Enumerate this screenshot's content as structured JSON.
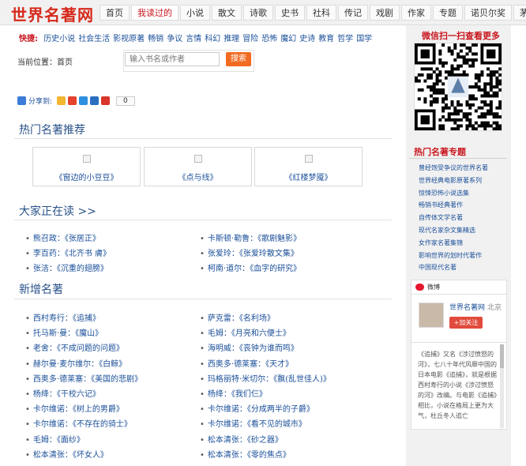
{
  "site": {
    "logo": "世界名著网"
  },
  "nav": [
    "首页",
    "我读过的",
    "小说",
    "散文",
    "诗歌",
    "史书",
    "社科",
    "传记",
    "戏剧",
    "作家",
    "专题",
    "诺贝尔奖",
    "茅奖"
  ],
  "nav_active_index": 1,
  "quick": {
    "label": "快捷:",
    "links": [
      "历史小说",
      "社会生活",
      "影视原著",
      "畅销",
      "争议",
      "言情",
      "科幻",
      "推理",
      "冒险",
      "恐怖",
      "魔幻",
      "史诗",
      "教育",
      "哲学",
      "国学"
    ]
  },
  "location": {
    "label": "当前位置：",
    "current": "首页"
  },
  "search": {
    "placeholder": "输入书名或作者",
    "button": "搜索"
  },
  "share": {
    "label": "分享到:",
    "count": "0"
  },
  "sections": {
    "hot": "热门名著推荐",
    "reading": "大家正在读 >>",
    "new": "新增名著"
  },
  "recommend": [
    "《窗边的小豆豆》",
    "《点与线》",
    "《红楼梦魇》"
  ],
  "reading_list": [
    {
      "author": "熊召政",
      "book": "《张居正》"
    },
    {
      "author": "卡斯顿·勒鲁",
      "book": "《歌剧魅影》"
    },
    {
      "author": "李百药",
      "book": "《北齐书 膚》"
    },
    {
      "author": "张爱玲",
      "book": "《张爱玲散文集》"
    },
    {
      "author": "张洁",
      "book": "《沉重的翅膀》"
    },
    {
      "author": "柯南·道尔",
      "book": "《血字的研究》"
    }
  ],
  "new_list": [
    {
      "author": "西村寿行",
      "book": "《追捕》"
    },
    {
      "author": "萨克雷",
      "book": "《名利场》"
    },
    {
      "author": "托马斯·曼",
      "book": "《魔山》"
    },
    {
      "author": "毛姆",
      "book": "《月亮和六便士》"
    },
    {
      "author": "老舍",
      "book": "《不成问题的问题》"
    },
    {
      "author": "海明威",
      "book": "《丧钟为谁而鸣》"
    },
    {
      "author": "赫尔曼·麦尔维尔",
      "book": "《白鲸》"
    },
    {
      "author": "西奥多·德莱塞",
      "book": "《天才》"
    },
    {
      "author": "西奥多·德莱塞",
      "book": "《美国的悲剧》"
    },
    {
      "author": "玛格丽特·米切尔",
      "book": "《飘(乱世佳人)》"
    },
    {
      "author": "杨绛",
      "book": "《干校六记》"
    },
    {
      "author": "杨绛",
      "book": "《我们仨》"
    },
    {
      "author": "卡尔维诺",
      "book": "《树上的男爵》"
    },
    {
      "author": "卡尔维诺",
      "book": "《分成两半的子爵》"
    },
    {
      "author": "卡尔维诺",
      "book": "《不存在的骑士》"
    },
    {
      "author": "卡尔维诺",
      "book": "《看不见的城市》"
    },
    {
      "author": "毛姆",
      "book": "《面纱》"
    },
    {
      "author": "松本清张",
      "book": "《砂之器》"
    },
    {
      "author": "松本清张",
      "book": "《坏女人》"
    },
    {
      "author": "松本清张",
      "book": "《零的焦点》"
    }
  ],
  "sidebar": {
    "qr_title": "微信扫一扫查看更多",
    "hot_title": "热门名著专题",
    "hot_items": [
      "曾经饱受争议的世界名著",
      "世界经典电影原著系列",
      "惊悚恐怖小说选集",
      "畅销书经典著作",
      "自传体文学名著",
      "现代名家杂文集精选",
      "女作家名著集锦",
      "影响世界的划时代著作",
      "中国现代名著"
    ],
    "weibo": {
      "label": "微博",
      "name": "世界名著网",
      "location": "北京",
      "follow": "+加关注",
      "text": "《追捕》又名《涉过愤怒的河》，七八十年代风靡中国的日本电影《追捕》，就是根据西村寿行的小说《涉过愤怒的河》改编。与电影《追捕》相比，小说在格局上更为大气，杜丘冬人追亡"
    }
  },
  "colors": {
    "brand_red": "#d62a1c",
    "link_blue": "#1a4f99",
    "search_orange": "#f26b22"
  }
}
